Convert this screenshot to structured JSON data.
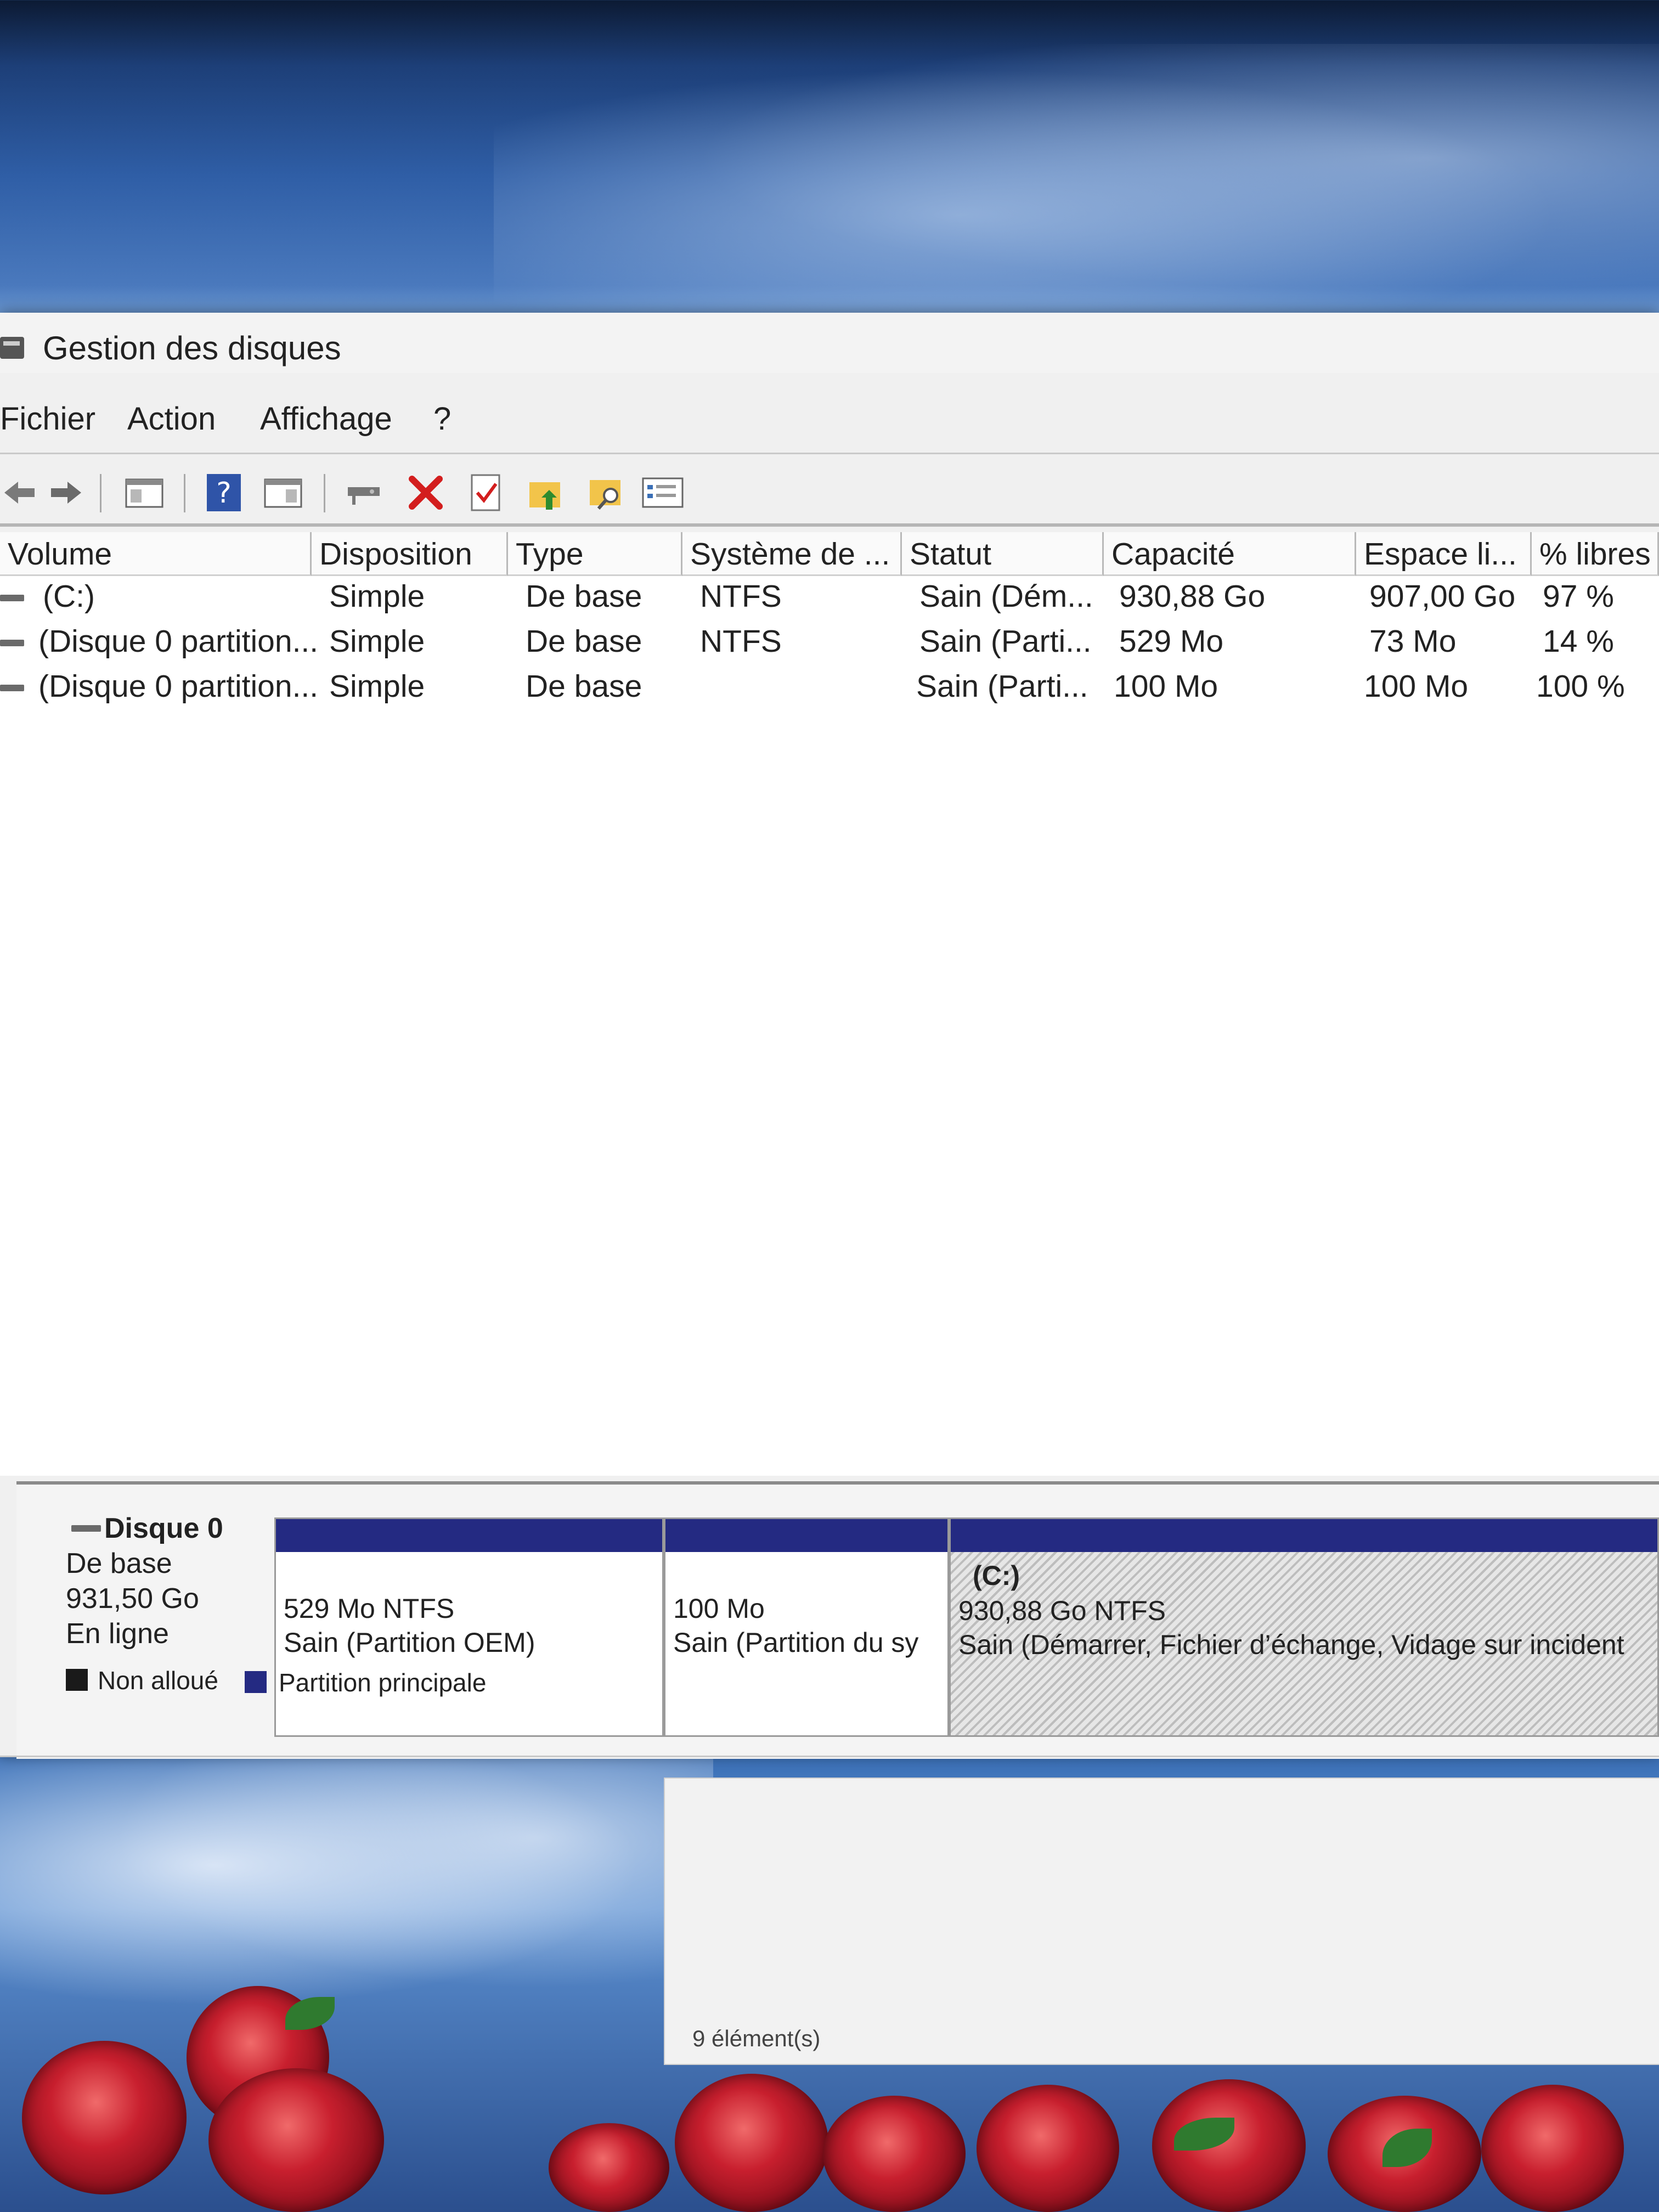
{
  "window": {
    "title": "Gestion des disques"
  },
  "menu": {
    "items": [
      "Fichier",
      "Action",
      "Affichage",
      "?"
    ]
  },
  "toolbar": {
    "icons": [
      "back-arrow-icon",
      "forward-arrow-icon",
      "console-tree-icon",
      "help-icon",
      "properties-icon",
      "connect-disk-icon",
      "delete-icon",
      "check-icon",
      "up-folder-icon",
      "search-folder-icon",
      "list-view-icon"
    ]
  },
  "volumes": {
    "columns": [
      "Volume",
      "Disposition",
      "Type",
      "Système de ...",
      "Statut",
      "Capacité",
      "Espace li...",
      "% libres"
    ],
    "rows": [
      {
        "volume": "(C:)",
        "disposition": "Simple",
        "type": "De base",
        "fs": "NTFS",
        "status": "Sain (Dém...",
        "capacity": "930,88 Go",
        "free": "907,00 Go",
        "pct": "97 %"
      },
      {
        "volume": "(Disque 0 partition...",
        "disposition": "Simple",
        "type": "De base",
        "fs": "NTFS",
        "status": "Sain (Parti...",
        "capacity": "529 Mo",
        "free": "73 Mo",
        "pct": "14 %"
      },
      {
        "volume": "(Disque 0 partition...",
        "disposition": "Simple",
        "type": "De base",
        "fs": "",
        "status": "Sain (Parti...",
        "capacity": "100 Mo",
        "free": "100 Mo",
        "pct": "100 %"
      }
    ]
  },
  "disk": {
    "name": "Disque 0",
    "type": "De base",
    "size": "931,50 Go",
    "state": "En ligne",
    "partitions": [
      {
        "line1": "",
        "line2": "529 Mo NTFS",
        "line3": "Sain (Partition OEM)"
      },
      {
        "line1": "",
        "line2": "100 Mo",
        "line3": "Sain (Partition du sy"
      },
      {
        "line1": "(C:)",
        "line2": "930,88 Go NTFS",
        "line3": "Sain (Démarrer, Fichier d’échange, Vidage sur incident"
      }
    ]
  },
  "legend": {
    "unallocated": "Non alloué",
    "primary": "Partition principale",
    "unallocated_color": "#1a1a1a",
    "primary_color": "#242a82"
  },
  "explorer": {
    "status": "9 élément(s)"
  }
}
